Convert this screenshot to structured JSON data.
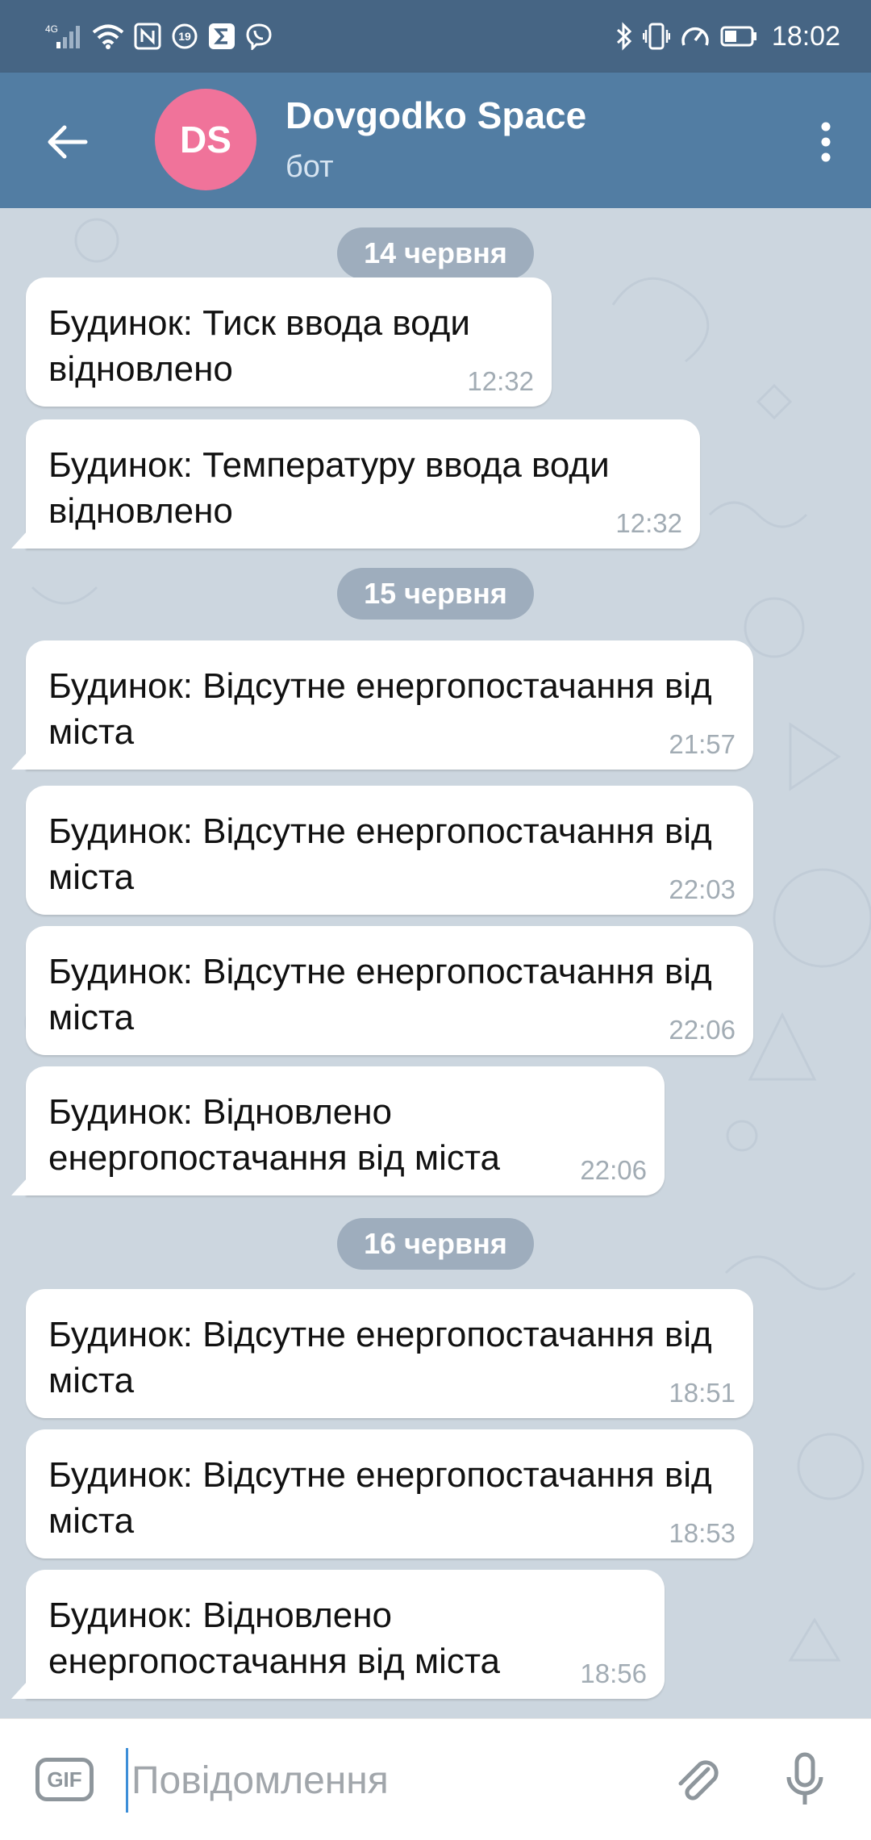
{
  "status_bar": {
    "network": "4G",
    "badge_count": "19",
    "time": "18:02"
  },
  "header": {
    "avatar_initials": "DS",
    "title": "Dovgodko Space",
    "subtitle": "бот"
  },
  "date_labels": [
    "14 червня",
    "15 червня",
    "16 червня"
  ],
  "messages": [
    {
      "text": "Будинок: Тиск ввода води відновлено",
      "time": "12:32"
    },
    {
      "text": "Будинок: Температуру ввода води відновлено",
      "time": "12:32"
    },
    {
      "text": "Будинок: Відсутне енергопостачання від міста",
      "time": "21:57"
    },
    {
      "text": "Будинок: Відсутне енергопостачання від міста",
      "time": "22:03"
    },
    {
      "text": "Будинок: Відсутне енергопостачання від міста",
      "time": "22:06"
    },
    {
      "text": "Будинок: Відновлено енергопостачання від міста",
      "time": "22:06"
    },
    {
      "text": "Будинок: Відсутне енергопостачання від міста",
      "time": "18:51"
    },
    {
      "text": "Будинок: Відсутне енергопостачання від міста",
      "time": "18:53"
    },
    {
      "text": "Будинок: Відновлено енергопостачання від міста",
      "time": "18:56"
    }
  ],
  "input": {
    "gif_label": "GIF",
    "placeholder": "Повідомлення"
  },
  "colors": {
    "status_bar": "#466584",
    "header": "#527da3",
    "avatar": "#f0739a",
    "chat_background": "#ccd6df",
    "bubble": "#ffffff",
    "cursor": "#3d8ed8"
  }
}
